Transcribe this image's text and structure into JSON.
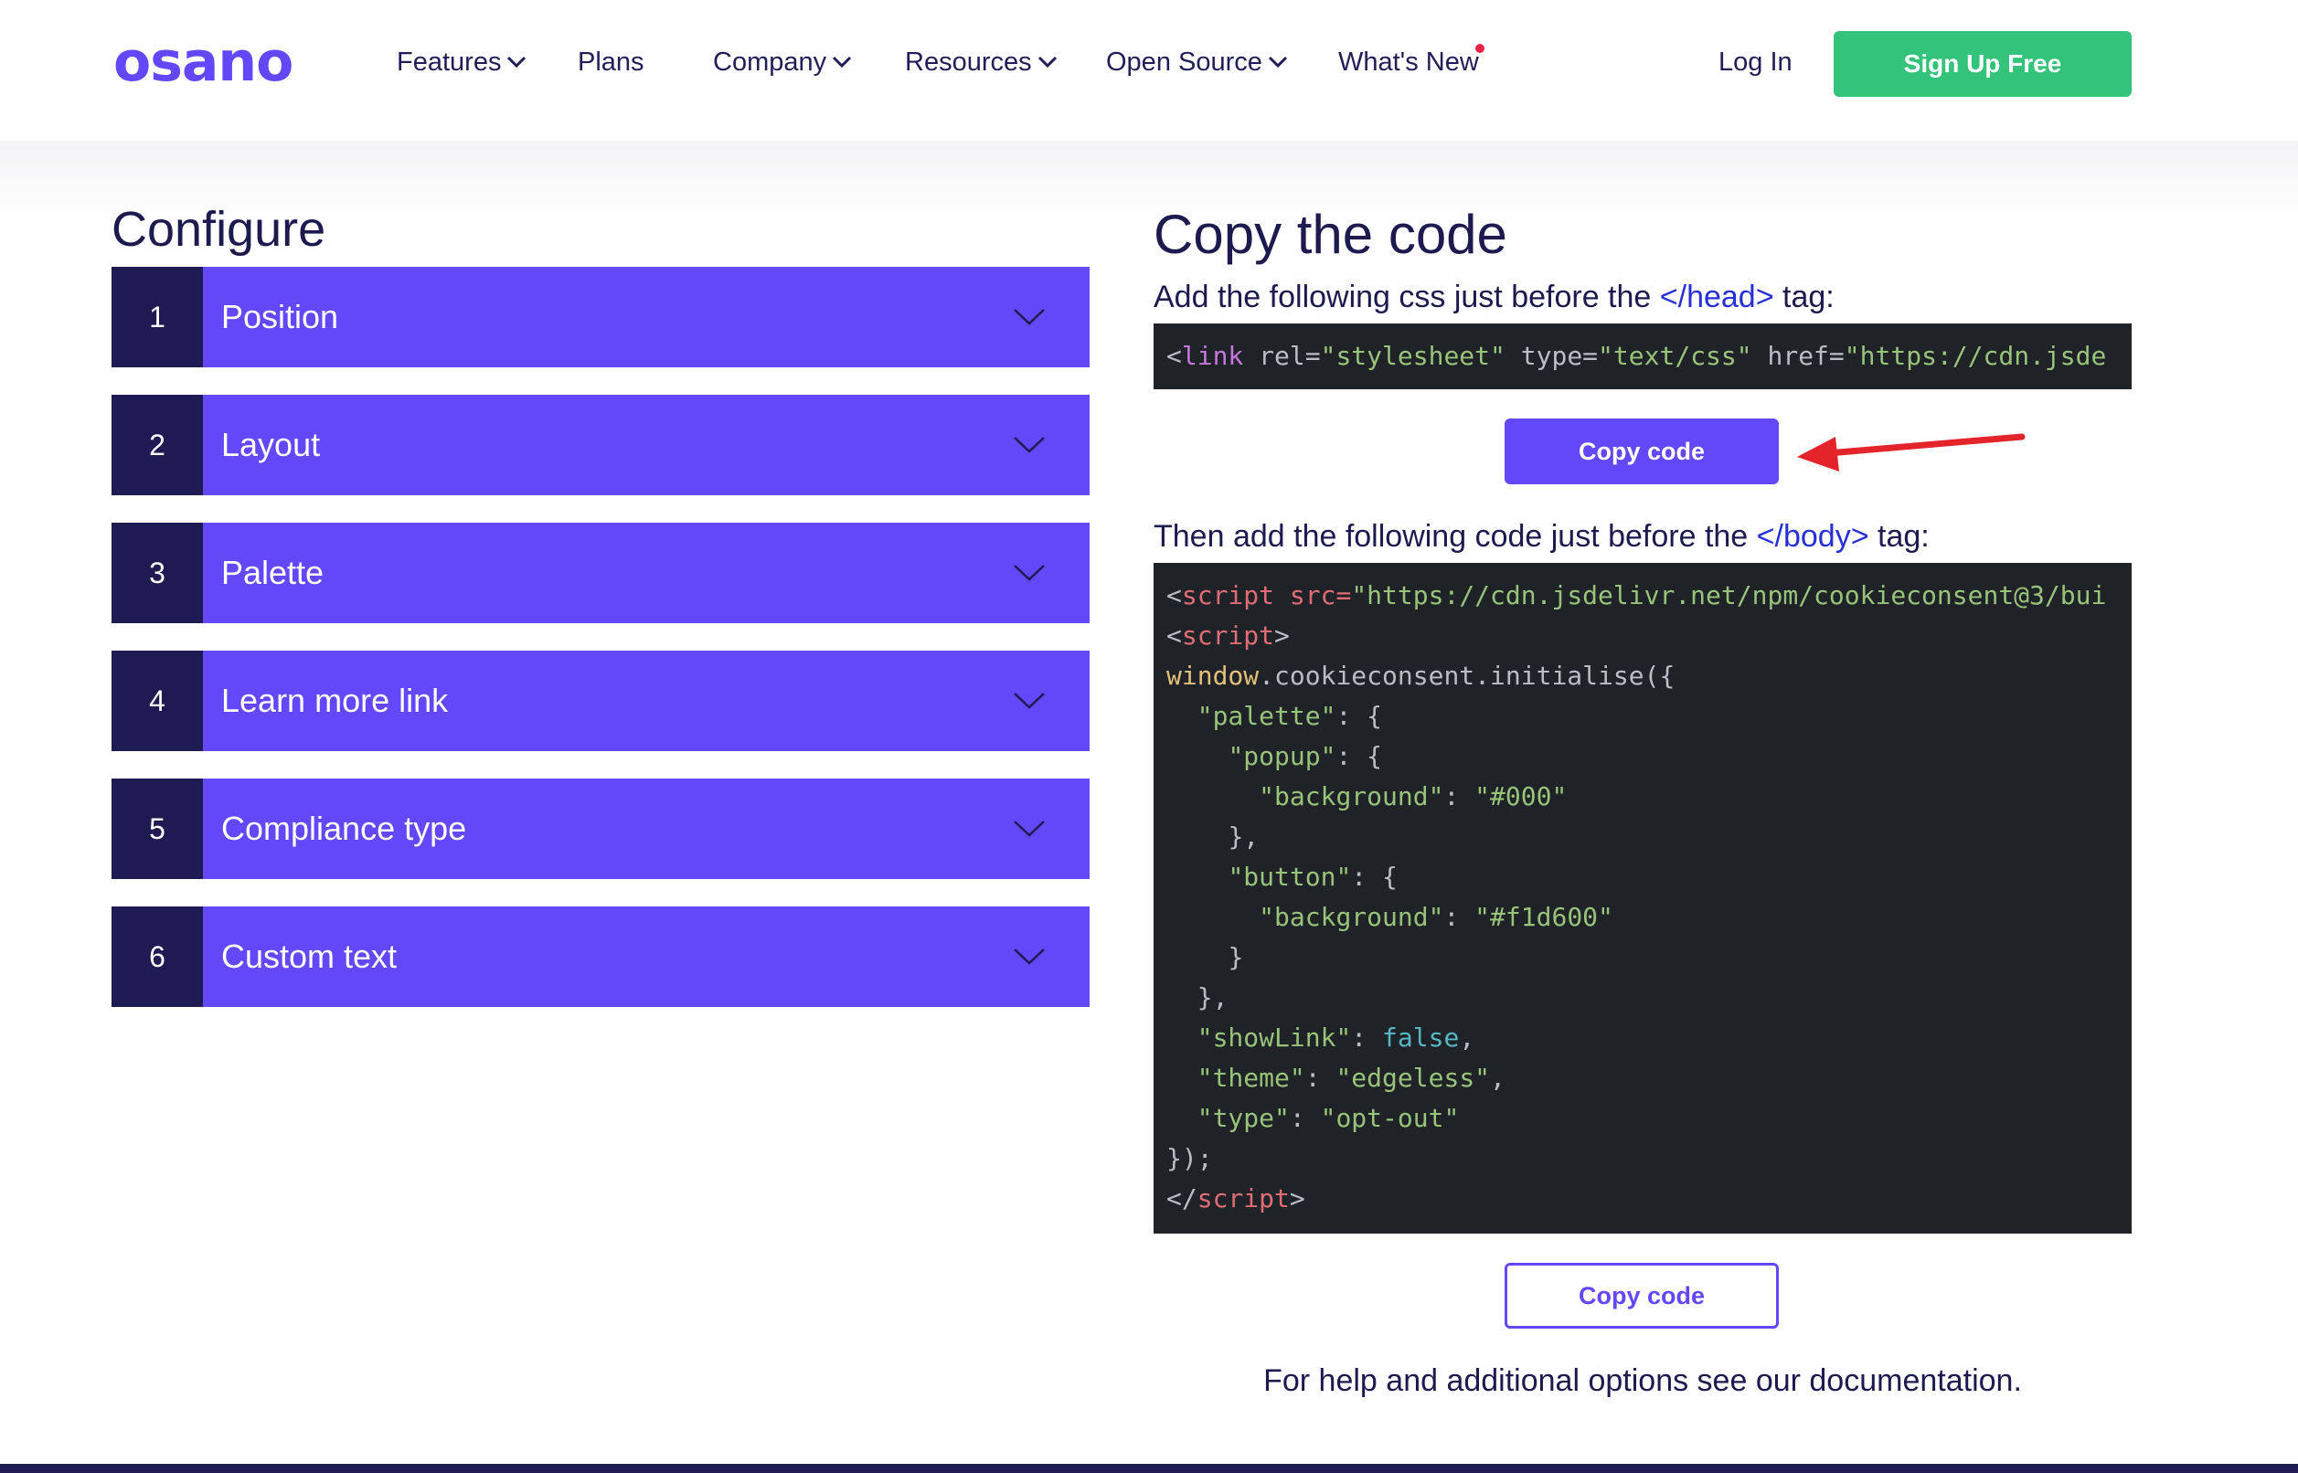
{
  "header": {
    "logo_text": "osano",
    "nav": [
      {
        "label": "Features",
        "dropdown": true
      },
      {
        "label": "Plans",
        "dropdown": false
      },
      {
        "label": "Company",
        "dropdown": true
      },
      {
        "label": "Resources",
        "dropdown": true
      },
      {
        "label": "Open Source",
        "dropdown": true
      },
      {
        "label": "What's New",
        "dropdown": false,
        "notification_dot": true
      }
    ],
    "login_label": "Log In",
    "signup_label": "Sign Up Free"
  },
  "configure": {
    "title": "Configure",
    "sections": [
      {
        "num": "1",
        "label": "Position"
      },
      {
        "num": "2",
        "label": "Layout"
      },
      {
        "num": "3",
        "label": "Palette"
      },
      {
        "num": "4",
        "label": "Learn more link"
      },
      {
        "num": "5",
        "label": "Compliance type"
      },
      {
        "num": "6",
        "label": "Custom text"
      }
    ]
  },
  "copy": {
    "title": "Copy the code",
    "css_instruction": {
      "before": "Add the following css just before the ",
      "tag": "</head>",
      "after": " tag:"
    },
    "css_code": {
      "open": "<",
      "tagname": "link",
      "attr1": " rel=",
      "val1": "\"stylesheet\"",
      "attr2": " type=",
      "val2": "\"text/css\"",
      "attr3": " href=",
      "val3": "\"https://cdn.jsde"
    },
    "copy_button_1": "Copy code",
    "js_instruction": {
      "before": "Then add the following code just before the ",
      "tag": "</body>",
      "after": " tag:"
    },
    "js_code": {
      "l1_open": "<",
      "l1_tag": "script",
      "l1_attr": " src=",
      "l1_val": "\"https://cdn.jsdelivr.net/npm/cookieconsent@3/bui",
      "l2_open": "<",
      "l2_tag": "script",
      "l2_close": ">",
      "l3_win": "window",
      "l3_rest": ".cookieconsent.initialise({",
      "l4_key": "\"palette\"",
      "l4_rest": ": {",
      "l5_key": "\"popup\"",
      "l5_rest": ": {",
      "l6_key": "\"background\"",
      "l6_mid": ": ",
      "l6_val": "\"#000\"",
      "l7": "},",
      "l8_key": "\"button\"",
      "l8_rest": ": {",
      "l9_key": "\"background\"",
      "l9_mid": ": ",
      "l9_val": "\"#f1d600\"",
      "l10": "}",
      "l11": "},",
      "l12_key": "\"showLink\"",
      "l12_mid": ": ",
      "l12_val": "false",
      "l12_end": ",",
      "l13_key": "\"theme\"",
      "l13_mid": ": ",
      "l13_val": "\"edgeless\"",
      "l13_end": ",",
      "l14_key": "\"type\"",
      "l14_mid": ": ",
      "l14_val": "\"opt-out\"",
      "l15": "});",
      "l16_open": "</",
      "l16_tag": "script",
      "l16_close": ">"
    },
    "copy_button_2": "Copy code",
    "help_text": "For help and additional options see our documentation."
  },
  "colors": {
    "brand_purple": "#6248f9",
    "dark_navy": "#1e1b52",
    "signup_green": "#33c37a",
    "code_bg": "#1f2328",
    "annotation_arrow": "#e3242b"
  }
}
